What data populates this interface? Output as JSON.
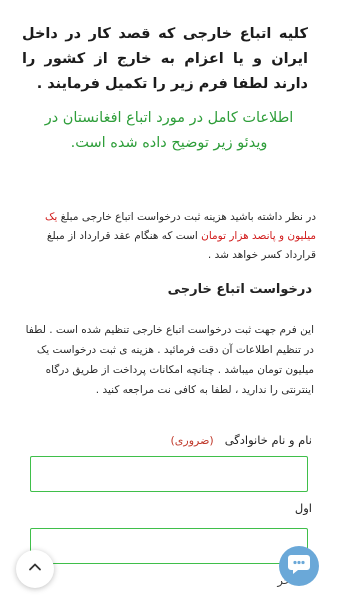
{
  "intro_text": "کلیه اتباع خارجی که قصد کار در داخل ایران و یا اعزام به خارج از کشور را دارند لطفا فرم زیر را تکمیل فرمایند .",
  "video_note": "اطلاعات کامل در مورد اتباع افغانستان در ویدئو زیر توضیح داده شده است.",
  "fee_notice": {
    "part1": "در نظر داشته باشید هزینه ثبت درخواست اتباع خارجی مبلغ ",
    "amount": "یک میلیون و پانصد هزار تومان",
    "part2": " است که هنگام عقد قرارداد از مبلغ قرارداد کسر خواهد شد ."
  },
  "section_title": "درخواست اتباع خارجی",
  "description": "این فرم جهت ثبت درخواست اتباع خارجی تنظیم شده است . لطفا در تنظیم اطلاعات آن دقت فرمائید . هزینه ی ثبت درخواست یک میلیون تومان میباشد . چنانچه امکانات پرداخت از طریق درگاه اینترنتی را ندارید ، لطفا به کافی نت مراجعه کنید .",
  "fields": {
    "fullname_label": "نام و نام خانوادگی",
    "required_tag": "(ضروری)",
    "fullname_value": "",
    "first_label": "اول",
    "first_value": "",
    "next_label_partial": "آخر"
  },
  "colors": {
    "accent_green": "#3fbf4a",
    "text_green": "#2e9e3a",
    "text_red": "#d11a1a",
    "fab_blue": "#6aa8d8"
  },
  "icons": {
    "scroll_top": "chevron-up-icon",
    "fab": "chat-bubble-icon"
  }
}
